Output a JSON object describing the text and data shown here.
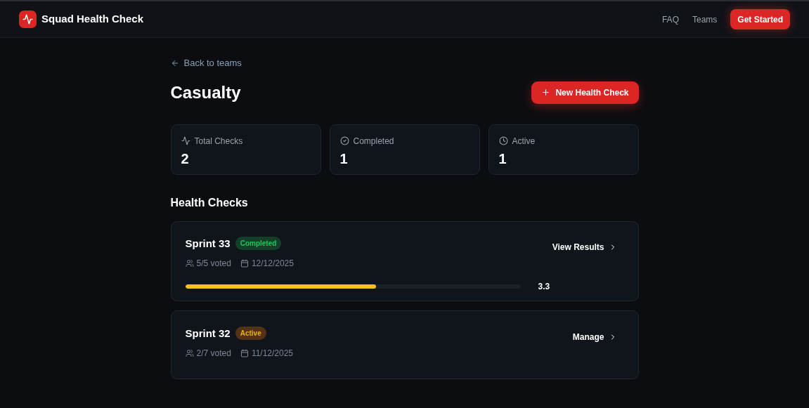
{
  "header": {
    "brand": "Squad Health Check",
    "nav": [
      "FAQ",
      "Teams"
    ],
    "cta": "Get Started"
  },
  "back_link": "Back to teams",
  "title": "Casualty",
  "new_button": "New Health Check",
  "stats": [
    {
      "kind": "pulse",
      "label": "Total Checks",
      "value": "2"
    },
    {
      "kind": "check",
      "label": "Completed",
      "value": "1"
    },
    {
      "kind": "clock",
      "label": "Active",
      "value": "1"
    }
  ],
  "section_title": "Health Checks",
  "checks": [
    {
      "name": "Sprint 33",
      "kind": "completed",
      "badge": "Completed",
      "votes": "5/5 voted",
      "date": "12/12/2025",
      "action": "View Results",
      "score": {
        "level": 0.57,
        "reading": "3.3"
      }
    },
    {
      "name": "Sprint 32",
      "kind": "active",
      "badge": "Active",
      "votes": "2/7 voted",
      "date": "11/12/2025",
      "action": "Manage"
    }
  ]
}
